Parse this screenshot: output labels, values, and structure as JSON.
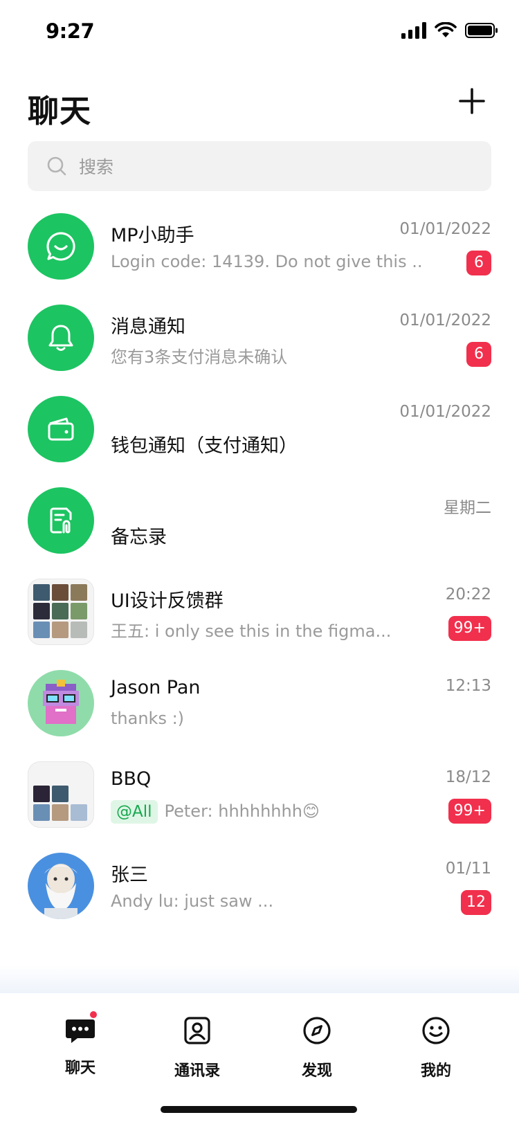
{
  "status": {
    "time": "9:27"
  },
  "header": {
    "title": "聊天"
  },
  "search": {
    "placeholder": "搜索"
  },
  "chats": [
    {
      "name": "MP小助手",
      "time": "01/01/2022",
      "preview": "Login code: 14139. Do not give this ...",
      "badge": "6",
      "icon": "whatsapp-smile-icon"
    },
    {
      "name": "消息通知",
      "time": "01/01/2022",
      "preview": "您有3条支付消息未确认",
      "badge": "6",
      "icon": "bell-icon"
    },
    {
      "name": "钱包通知（支付通知）",
      "time": "01/01/2022",
      "icon": "wallet-icon"
    },
    {
      "name": "备忘录",
      "time": "星期二",
      "icon": "memo-icon"
    },
    {
      "name": "UI设计反馈群",
      "time": "20:22",
      "preview": "王五: i only see this in the figma...",
      "badge": "99+",
      "icon": "group-avatar-grid"
    },
    {
      "name": "Jason Pan",
      "time": "12:13",
      "preview": "thanks :)",
      "icon": "pixel-avatar"
    },
    {
      "name": "BBQ",
      "time": "18/12",
      "mention": "@All",
      "preview": "Peter: hhhhhhhh😊",
      "badge": "99+",
      "icon": "group-avatar-grid"
    },
    {
      "name": "张三",
      "time": "01/11",
      "preview": "Andy lu: just saw ...",
      "badge": "12",
      "icon": "portrait-avatar"
    }
  ],
  "tabs": [
    {
      "label": "聊天",
      "icon": "chat-bubble-icon"
    },
    {
      "label": "通讯录",
      "icon": "contacts-icon"
    },
    {
      "label": "发现",
      "icon": "compass-icon"
    },
    {
      "label": "我的",
      "icon": "smiley-icon"
    }
  ],
  "colors": {
    "accent": "#1dc462",
    "badge": "#f1304d",
    "mention_bg": "#dff6e6",
    "mention_text": "#17a84f"
  }
}
